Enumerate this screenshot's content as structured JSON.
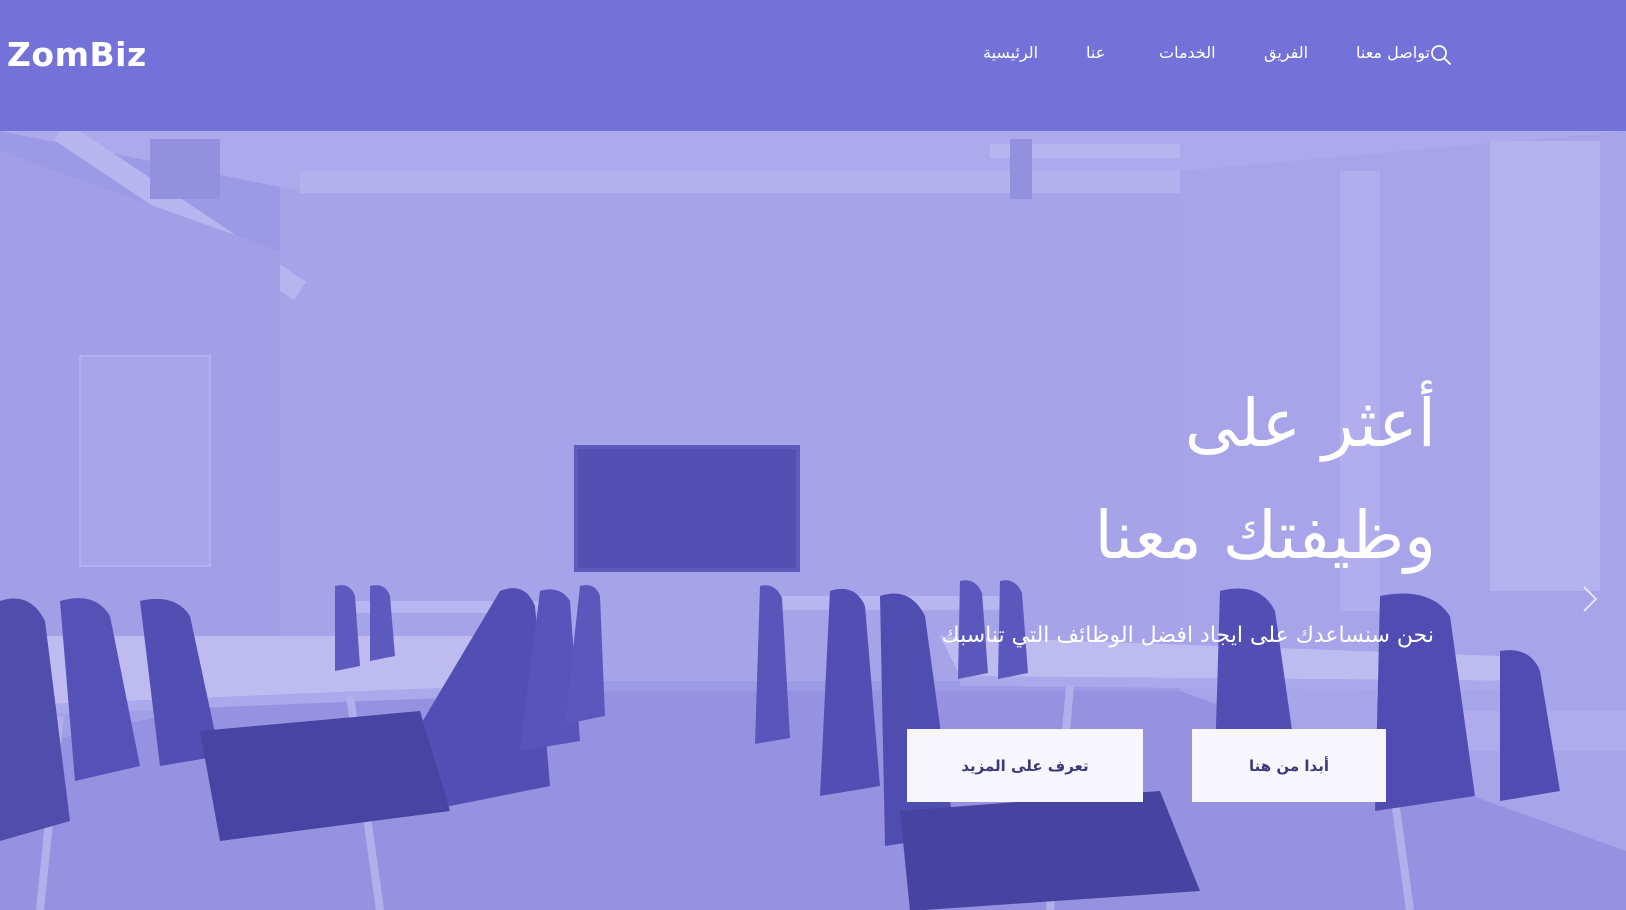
{
  "brand": {
    "logo_text": "ZomBiz"
  },
  "nav": {
    "items": [
      {
        "label": "الرئيسية",
        "name": "nav-item-home"
      },
      {
        "label": "عنا",
        "name": "nav-item-about"
      },
      {
        "label": "الخدمات",
        "name": "nav-item-services"
      },
      {
        "label": "الفريق",
        "name": "nav-item-team"
      },
      {
        "label": "تواصل معنا",
        "name": "nav-item-contact"
      }
    ],
    "search_icon": "search-icon"
  },
  "hero": {
    "title_line1": "أعثر على",
    "title_line2": "وظيفتك معنا",
    "subtitle": "نحن سنساعدك على ايجاد افضل الوظائف التي تناسبك",
    "primary_button": "أبدا من هنا",
    "secondary_button": "تعرف على المزيد",
    "next_icon": "chevron-right-icon"
  },
  "colors": {
    "header_bg": "#7372d9",
    "hero_tint": "#a6a3e6",
    "button_bg": "#f7f6fc",
    "button_text": "#3d3a7c"
  }
}
